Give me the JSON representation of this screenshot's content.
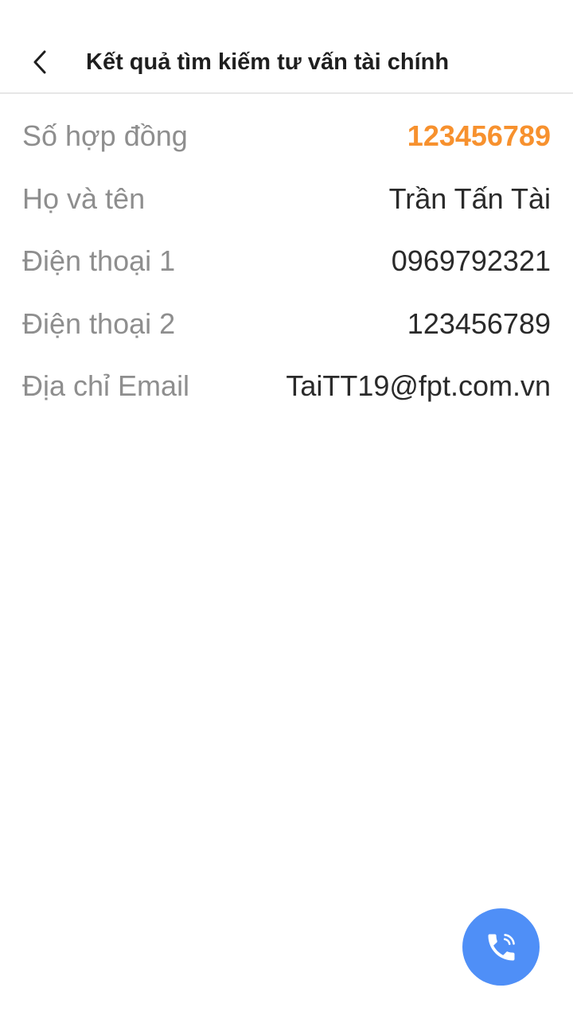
{
  "header": {
    "title": "Kết quả tìm kiếm tư vấn tài chính",
    "back_icon": "chevron-left-icon"
  },
  "details": [
    {
      "label": "Số hợp đồng",
      "value": "123456789",
      "highlight": true
    },
    {
      "label": "Họ và tên",
      "value": "Trần Tấn Tài",
      "highlight": false
    },
    {
      "label": "Điện thoại 1",
      "value": "0969792321",
      "highlight": false
    },
    {
      "label": "Điện thoại 2",
      "value": "123456789",
      "highlight": false
    },
    {
      "label": "Địa chỉ Email",
      "value": "TaiTT19@fpt.com.vn",
      "highlight": false
    }
  ],
  "call_button": {
    "icon": "phone-call-icon",
    "color": "#4f8ff7"
  },
  "colors": {
    "accent": "#f7912e",
    "label": "#8e8e8e",
    "value": "#2a2a2a"
  }
}
